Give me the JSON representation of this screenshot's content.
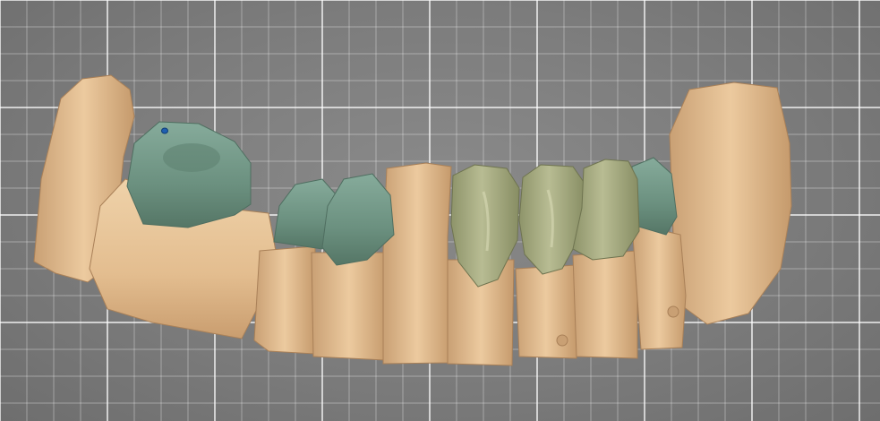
{
  "viewport": {
    "background": "#7b7b7b",
    "grid_color": "#ffffff"
  },
  "model": {
    "stone_color": "#e8c59a",
    "stone_shadow": "#b98f63",
    "prep_crown_color": "#6f9586",
    "bridge_color": "#a2a77d",
    "margin_marker_color": "#1f5fb0"
  }
}
